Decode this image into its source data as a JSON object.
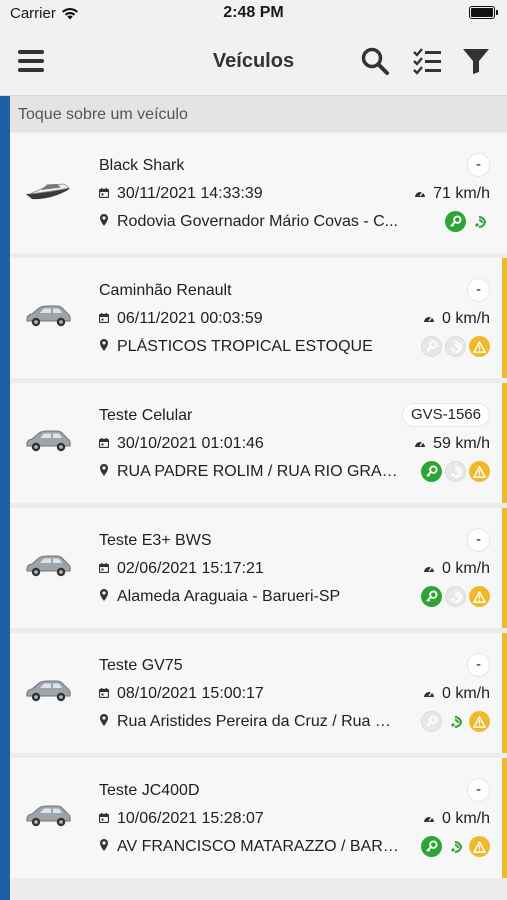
{
  "status_bar": {
    "carrier": "Carrier",
    "time": "2:48 PM"
  },
  "nav": {
    "title": "Veículos"
  },
  "hint": "Toque sobre um veículo",
  "colors": {
    "accent": "#1f5fa6",
    "warning": "#f0b929",
    "ok": "#2ea336"
  },
  "vehicles": [
    {
      "name": "Black Shark",
      "plate": "-",
      "date": "30/11/2021 14:33:39",
      "speed": "71 km/h",
      "address": "Rodovia Governador Mário Covas - C...",
      "type": "boat-icon",
      "warning": false,
      "ignition": "on",
      "signal": "on",
      "alert": false
    },
    {
      "name": "Caminhão Renault",
      "plate": "-",
      "date": "06/11/2021 00:03:59",
      "speed": "0 km/h",
      "address": "PLÁSTICOS TROPICAL ESTOQUE",
      "type": "car-icon",
      "warning": true,
      "ignition": "off",
      "signal": "off",
      "alert": true
    },
    {
      "name": "Teste Celular",
      "plate": "GVS-1566",
      "date": "30/10/2021 01:01:46",
      "speed": "59 km/h",
      "address": "RUA PADRE ROLIM / RUA RIO GRAN...",
      "type": "car-icon",
      "warning": true,
      "ignition": "on",
      "signal": "off",
      "alert": true
    },
    {
      "name": "Teste E3+ BWS",
      "plate": "-",
      "date": "02/06/2021 15:17:21",
      "speed": "0 km/h",
      "address": "Alameda Araguaia - Barueri-SP",
      "type": "car-icon",
      "warning": true,
      "ignition": "on",
      "signal": "off",
      "alert": true
    },
    {
      "name": "Teste GV75",
      "plate": "-",
      "date": "08/10/2021 15:00:17",
      "speed": "0 km/h",
      "address": "Rua Aristides Pereira da Cruz / Rua Co...",
      "type": "car-icon",
      "warning": true,
      "ignition": "off",
      "signal": "on",
      "alert": true
    },
    {
      "name": "Teste JC400D",
      "plate": "-",
      "date": "10/06/2021 15:28:07",
      "speed": "0 km/h",
      "address": "AV FRANCISCO MATARAZZO / BARRA F...",
      "type": "car-icon",
      "warning": true,
      "ignition": "on",
      "signal": "on",
      "alert": true
    }
  ]
}
